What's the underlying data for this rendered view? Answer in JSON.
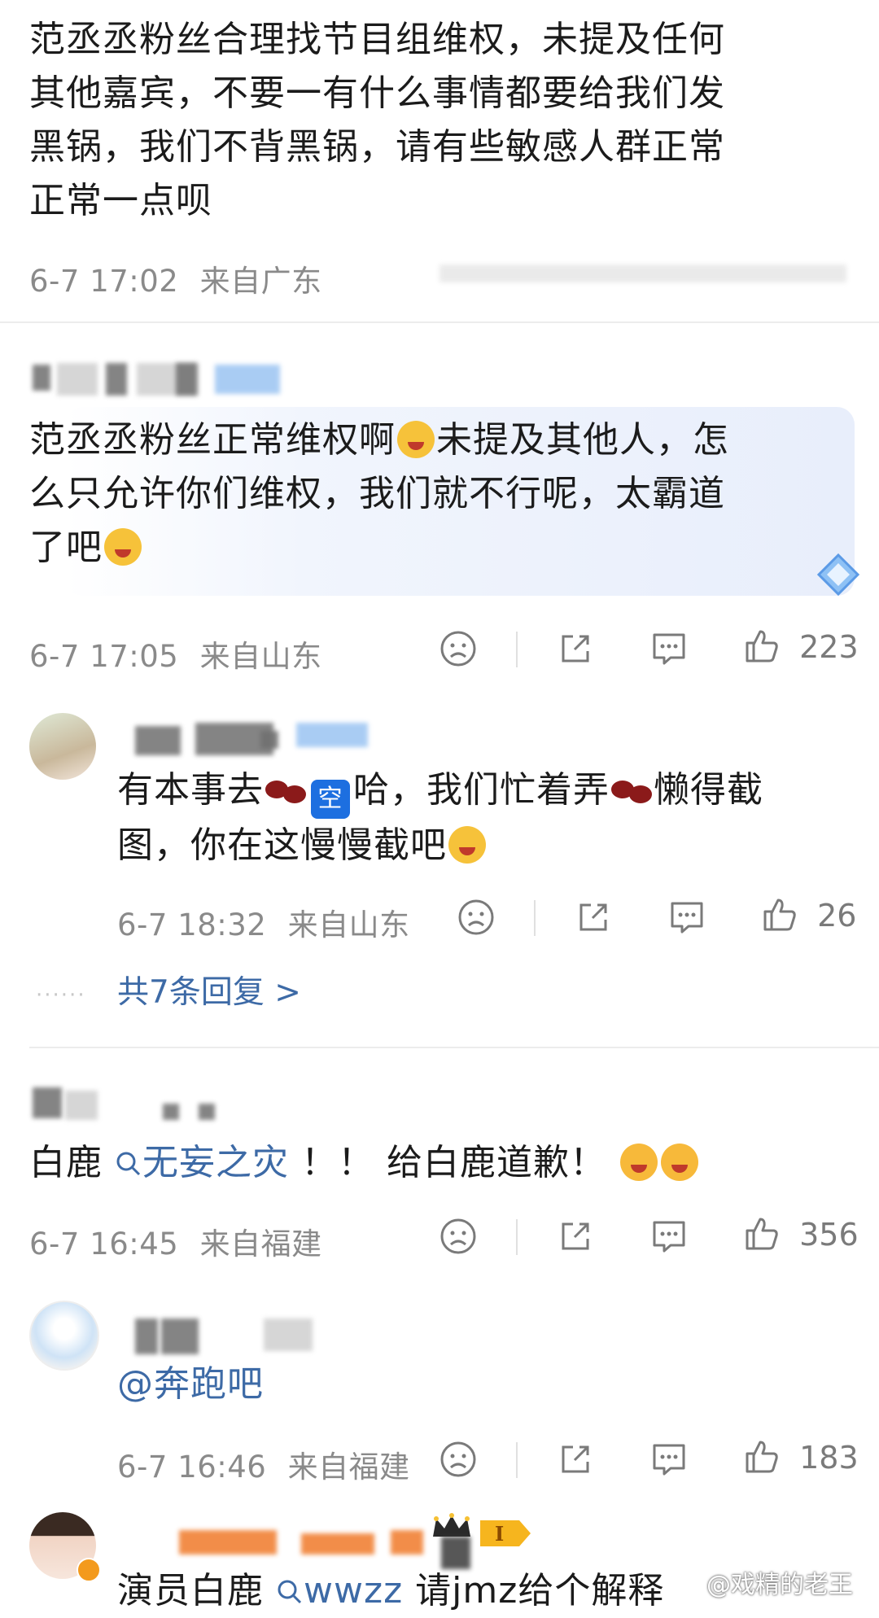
{
  "comments": [
    {
      "text": "范丞丞粉丝合理找节目组维权，未提及任何其他嘉宾，不要一有什么事情都要给我们发黑锅，我们不背黑锅，请有些敏感人群正常正常一点呗",
      "line1": "范丞丞粉丝合理找节目组维权，未提及任何",
      "line2": "其他嘉宾，不要一有什么事情都要给我们发",
      "line3": "黑锅，我们不背黑锅，请有些敏感人群正常",
      "line4": "正常一点呗",
      "time": "6-7 17:02",
      "location": "来自广东"
    },
    {
      "text_a": "范丞丞粉丝正常维权啊",
      "text_b": "未提及其他人，怎",
      "text_c": "么只允许你们维权，我们就不行呢，太霸道",
      "text_d": "了吧",
      "time": "6-7 17:05",
      "location": "来自山东",
      "likes": "223"
    },
    {
      "reply": true,
      "text_a": "有本事去",
      "kong": "空",
      "text_b": "哈，我们忙着弄",
      "text_c": "懒得截",
      "text_d": "图，你在这慢慢截吧",
      "time": "6-7 18:32",
      "location": "来自山东",
      "likes": "26",
      "more": "共7条回复 >"
    },
    {
      "text_a": "白鹿",
      "topic": "无妄之灾",
      "text_b": "！！ 给白鹿道歉！",
      "time": "6-7 16:45",
      "location": "来自福建",
      "likes": "356"
    },
    {
      "reply": true,
      "mention": "@奔跑吧",
      "time": "6-7 16:46",
      "location": "来自福建",
      "likes": "183"
    },
    {
      "reply": true,
      "text_a": "演员白鹿",
      "topic": "wwzz",
      "text_b": "请jmz给个解释"
    }
  ],
  "watermark": "@戏精的老王",
  "icons": {
    "dislike": "sad-face-icon",
    "share": "share-icon",
    "comment": "comment-icon",
    "like": "thumbs-up-icon",
    "search": "search-icon"
  },
  "colors": {
    "link": "#3d6aa6",
    "meta": "#8a8a8a"
  }
}
